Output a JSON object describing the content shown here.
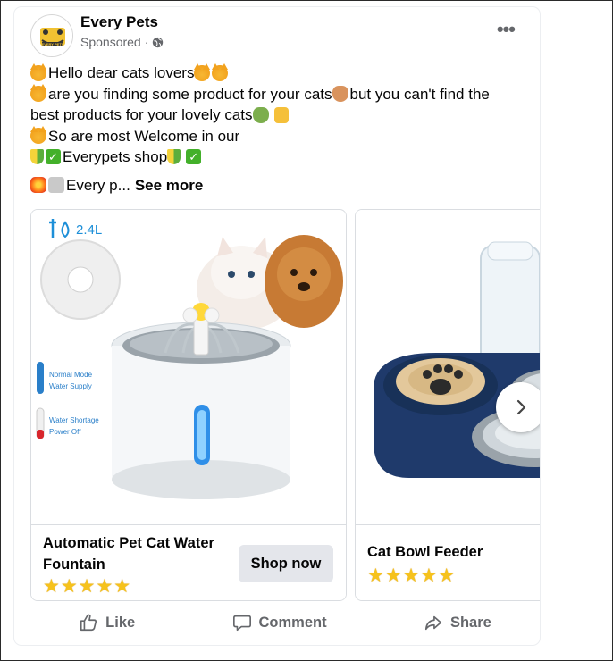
{
  "post": {
    "page_name": "Every Pets",
    "sponsored_label": "Sponsored",
    "separator": "·",
    "more_icon_label": "•••",
    "lines": [
      "Hello dear cats lovers",
      "are you finding some product for your cats",
      "but you can't find the",
      "best products for your lovely cats",
      "So are most Welcome in our",
      "Everypets shop",
      "Every p..."
    ],
    "see_more": "See more",
    "avatar_text": "EVERY PETS"
  },
  "carousel": {
    "items": [
      {
        "title_line1": "Automatic Pet Cat Water",
        "title_line2": "Fountain",
        "cta": "Shop now",
        "rating": "★★★★★",
        "capacity": "2.4L",
        "mode_normal": "Normal Mode",
        "mode_normal_sub": "Water Supply",
        "mode_shortage": "Water Shortage",
        "mode_shortage_sub": "Power Off"
      },
      {
        "title": "Cat Bowl Feeder",
        "rating": "★★★★★"
      }
    ]
  },
  "actions": {
    "like": "Like",
    "comment": "Comment",
    "share": "Share"
  },
  "colors": {
    "secondary_text": "#65676b",
    "button_bg": "#e4e6eb",
    "star": "#f6c21c"
  }
}
